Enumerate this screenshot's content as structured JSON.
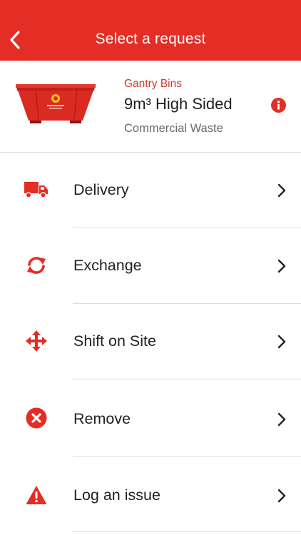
{
  "header": {
    "title": "Select a request",
    "back_icon": "chevron-left-icon",
    "background_color": "#e32d25"
  },
  "product": {
    "category": "Gantry Bins",
    "name": "9m³ High Sided",
    "waste_type": "Commercial Waste",
    "image": "skip-bin-image",
    "info_icon": "info-icon"
  },
  "menu": {
    "items": [
      {
        "label": "Delivery",
        "icon": "truck-icon"
      },
      {
        "label": "Exchange",
        "icon": "refresh-icon"
      },
      {
        "label": "Shift on Site",
        "icon": "move-arrows-icon"
      },
      {
        "label": "Remove",
        "icon": "remove-circle-icon"
      },
      {
        "label": "Log an issue",
        "icon": "warning-icon"
      }
    ]
  },
  "colors": {
    "accent": "#e32d25",
    "category_text": "#d9342b",
    "divider": "#dcdcdc"
  }
}
